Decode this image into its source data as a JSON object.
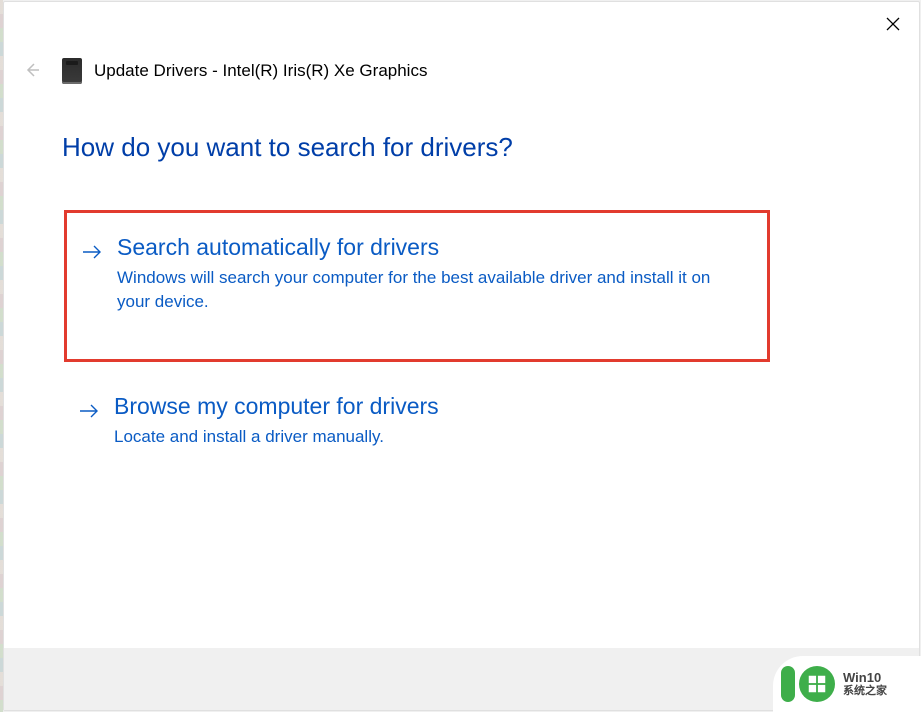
{
  "dialog": {
    "title": "Update Drivers - Intel(R) Iris(R) Xe Graphics"
  },
  "heading": "How do you want to search for drivers?",
  "options": [
    {
      "title": "Search automatically for drivers",
      "description": "Windows will search your computer for the best available driver and install it on your device."
    },
    {
      "title": "Browse my computer for drivers",
      "description": "Locate and install a driver manually."
    }
  ],
  "watermark": {
    "line1": "Win10",
    "line2": "系统之家"
  }
}
